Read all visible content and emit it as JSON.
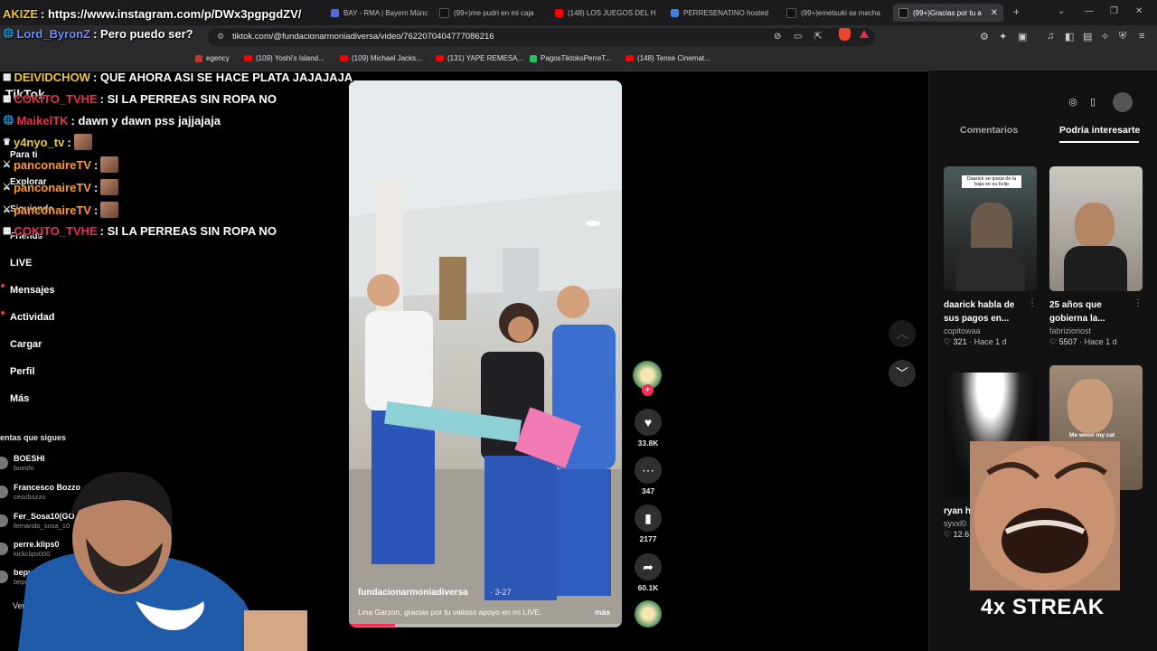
{
  "browser": {
    "tabs": [
      {
        "title": "BAY - RMA | Bayern Münc",
        "icon": "generic-icon",
        "color": "#5b6ad0"
      },
      {
        "title": "(99+)me pudri en mi caja",
        "icon": "tiktok-icon",
        "color": "#111111"
      },
      {
        "title": "(148) LOS JUEGOS DEL H",
        "icon": "youtube-icon",
        "color": "#ff0000"
      },
      {
        "title": "PERRESENATINO hosted",
        "icon": "generic-icon",
        "color": "#4a7fd6"
      },
      {
        "title": "(99+)emetsuki se mecha",
        "icon": "tiktok-icon",
        "color": "#111111"
      },
      {
        "title": "(99+)Gracias por tu a",
        "icon": "tiktok-icon",
        "color": "#111111"
      }
    ],
    "url": "tiktok.com/@fundacionarmoniadiversa/video/7622070404777086216",
    "bookmarks": [
      {
        "label": "egency",
        "icon": "generic-icon"
      },
      {
        "label": "(109) Yoshi's Island...",
        "icon": "youtube-icon"
      },
      {
        "label": "(109) Michael Jacks...",
        "icon": "youtube-icon"
      },
      {
        "label": "(131) YAPE REMESA...",
        "icon": "youtube-icon"
      },
      {
        "label": "PagosTiktoksPerreT...",
        "icon": "sheets-icon"
      },
      {
        "label": "(148) Tense Cinemat...",
        "icon": "youtube-icon"
      }
    ]
  },
  "tiktok": {
    "logo": "TikTok",
    "nav": [
      {
        "label": "Para ti",
        "icon": "home-icon"
      },
      {
        "label": "Explorar",
        "icon": "compass-icon"
      },
      {
        "label": "Siguiendo",
        "icon": "users-icon"
      },
      {
        "label": "Friends",
        "icon": "friends-icon"
      },
      {
        "label": "LIVE",
        "icon": "live-icon"
      },
      {
        "label": "Mensajes",
        "icon": "message-icon"
      },
      {
        "label": "Actividad",
        "icon": "bell-icon"
      },
      {
        "label": "Cargar",
        "icon": "upload-icon"
      },
      {
        "label": "Perfil",
        "icon": "profile-icon"
      },
      {
        "label": "Más",
        "icon": "more-icon"
      }
    ],
    "following_heading": "entas que sigues",
    "following": [
      {
        "name": "BOESHI",
        "handle": "boeshi"
      },
      {
        "name": "Francesco Bozzo",
        "handle": "cescbozzo"
      },
      {
        "name": "Fer_Sosa10(GO",
        "handle": "fernando_sosa_10"
      },
      {
        "name": "perre.klips0",
        "handle": "kickclips000"
      },
      {
        "name": "bepucho",
        "handle": "bepucho"
      }
    ],
    "see_more": "Ver to",
    "video": {
      "author": "fundacionarmoniadiversa",
      "date": "· 3-27",
      "caption": "Lina Garzon, gracias por tu valioso apoyo en mi LIVE.",
      "more": "más",
      "progress_fraction": 0.17
    },
    "actions": {
      "likes": "33.8K",
      "comments": "347",
      "saves": "2177",
      "shares": "60.1K"
    },
    "right_panel": {
      "tab_comments": "Comentarios",
      "tab_related": "Podría interesarte",
      "cards": [
        {
          "title": "daarick habla de sus pagos en...",
          "author": "copitowaa",
          "likes": "321",
          "age": "Hace 1 d",
          "thumb_text": "Daarick se queja de la baja en su kclip"
        },
        {
          "title": "25 años que gobierna la...",
          "author": "fabrizioriost",
          "likes": "5507",
          "age": "Hace 1 d",
          "thumb_text": ""
        },
        {
          "title": "ryan h thragg",
          "author": "syvxl0",
          "likes": "12.6",
          "age": "d",
          "thumb_text": ""
        },
        {
          "title": "",
          "author": "",
          "likes": "",
          "age": "",
          "thumb_text": "Me wnon my cat"
        }
      ]
    }
  },
  "chat": [
    {
      "user": "AKIZE",
      "color": "#f2c82d",
      "message": ": https://www.instagram.com/p/DWx3pgpgdZV/"
    },
    {
      "user": "Lord_ByronZ",
      "color": "#6e8cf7",
      "message": ": Pero puedo ser?"
    },
    {
      "user": "DEIVIDCHOW",
      "color": "#f2c82d",
      "message": ": QUE AHORA ASI SE HACE PLATA JAJAJAJA"
    },
    {
      "user": "COKITO_TVHE",
      "color": "#e8324a",
      "message": ": SI LA PERREAS SIN ROPA NO"
    },
    {
      "user": "MaikelTK",
      "color": "#e8324a",
      "message": ": dawn y dawn pss jajjajaja"
    },
    {
      "user": "y4nyo_tv",
      "color": "#f2c82d",
      "message": ":"
    },
    {
      "user": "panconaireTV",
      "color": "#ff9a2e",
      "message": ":"
    },
    {
      "user": "panconaireTV",
      "color": "#ff9a2e",
      "message": ":"
    },
    {
      "user": "panconaireTV",
      "color": "#ff9a2e",
      "message": ":"
    },
    {
      "user": "COKITO_TVHE",
      "color": "#e8324a",
      "message": ": SI LA PERREAS SIN ROPA NO"
    }
  ],
  "overlay": {
    "streak": "4x STREAK"
  }
}
